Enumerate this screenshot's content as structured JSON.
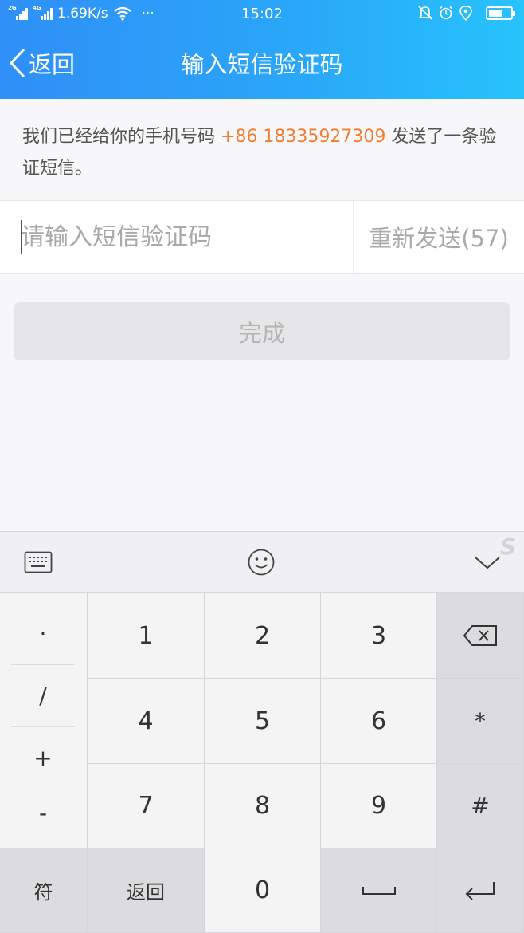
{
  "status_bar": {
    "net_2g": "2G",
    "net_4g": "4G",
    "speed": "1.69K/s",
    "more": "···",
    "time": "15:02",
    "battery_level": 0.6
  },
  "nav": {
    "back_label": "返回",
    "title": "输入短信验证码"
  },
  "info": {
    "prefix": "我们已经给你的手机号码 ",
    "phone": "+86 18335927309",
    "suffix": " 发送了一条验证短信。"
  },
  "code": {
    "placeholder": "请输入短信验证码",
    "value": "",
    "resend_label": "重新发送(57)"
  },
  "done_label": "完成",
  "keyboard": {
    "symbols": [
      "·",
      "/",
      "+",
      "-"
    ],
    "digits": [
      "1",
      "2",
      "3",
      "4",
      "5",
      "6",
      "7",
      "8",
      "9",
      "0"
    ],
    "star": "*",
    "hash": "#",
    "fu_label": "符",
    "back_label": "返回"
  },
  "colors": {
    "header_start": "#2f8ff7",
    "header_end": "#27c3fb",
    "phone_accent": "#f27d32"
  }
}
